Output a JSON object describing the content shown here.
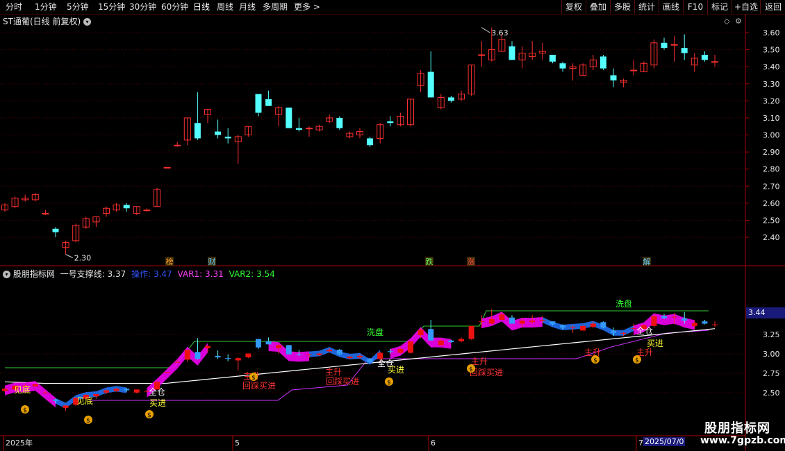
{
  "toolbar": {
    "timeframes": [
      "分时",
      "1分钟",
      "5分钟",
      "15分钟",
      "30分钟",
      "60分钟",
      "日线",
      "周线",
      "月线",
      "多周期",
      "更多 >"
    ],
    "active": "日线",
    "right_buttons": [
      "复权",
      "叠加",
      "多股",
      "统计",
      "画线",
      "F10",
      "标记",
      "+自选",
      "返回"
    ]
  },
  "main_chart": {
    "title": "ST通葡(日线 前复权)",
    "high_label": "3.63",
    "low_label": "2.30",
    "price_ticks": [
      "3.60",
      "3.50",
      "3.40",
      "3.30",
      "3.20",
      "3.10",
      "3.00",
      "2.90",
      "2.80",
      "2.70",
      "2.60",
      "2.50",
      "2.40"
    ],
    "event_markers": [
      {
        "label": "榜",
        "color": "#ffa040"
      },
      {
        "label": "财",
        "color": "#66ccff"
      },
      {
        "label": "跌",
        "color": "#66ff66"
      },
      {
        "label": "涨",
        "color": "#ff5050"
      },
      {
        "label": "解",
        "color": "#66ccff"
      }
    ]
  },
  "indicator": {
    "name": "股朋指标网",
    "line1_label": "一号支撑线:",
    "line1_value": "3.37",
    "op_label": "操作:",
    "op_value": "3.47",
    "var1_label": "VAR1:",
    "var1_value": "3.31",
    "var2_label": "VAR2:",
    "var2_value": "3.54",
    "ticks": [
      "3.25",
      "3.00",
      "2.75",
      "2.50"
    ],
    "current_price": "3.44",
    "signals": {
      "jiandi": "见底",
      "quancang": "全仓",
      "mairu": "买进",
      "xipan": "洗盘",
      "zhusheng": "主升",
      "huicai": "回踩买进"
    }
  },
  "x_axis": {
    "labels": [
      "2025年",
      "5",
      "6",
      "7"
    ],
    "current_date": "2025/07/0"
  },
  "watermark": {
    "line1": "股朋指标网",
    "line2": "www.7gpzb.com"
  },
  "colors": {
    "up": "#ff3030",
    "down": "#54ffff",
    "grid": "#5a0000",
    "axis": "#aa0000",
    "magenta": "#ff00ff",
    "white": "#ffffff",
    "green": "#33ff33",
    "purple": "#cc33ff"
  },
  "chart_data": {
    "type": "candlestick",
    "price_range": [
      2.3,
      3.63
    ],
    "candles": [
      {
        "o": 2.56,
        "h": 2.6,
        "l": 2.55,
        "c": 2.59
      },
      {
        "o": 2.58,
        "h": 2.64,
        "l": 2.57,
        "c": 2.63
      },
      {
        "o": 2.62,
        "h": 2.65,
        "l": 2.61,
        "c": 2.63
      },
      {
        "o": 2.62,
        "h": 2.66,
        "l": 2.61,
        "c": 2.65
      },
      {
        "o": 2.54,
        "h": 2.56,
        "l": 2.53,
        "c": 2.54
      },
      {
        "o": 2.45,
        "h": 2.46,
        "l": 2.4,
        "c": 2.43
      },
      {
        "o": 2.34,
        "h": 2.38,
        "l": 2.3,
        "c": 2.37
      },
      {
        "o": 2.38,
        "h": 2.48,
        "l": 2.37,
        "c": 2.47
      },
      {
        "o": 2.46,
        "h": 2.52,
        "l": 2.45,
        "c": 2.51
      },
      {
        "o": 2.49,
        "h": 2.52,
        "l": 2.46,
        "c": 2.52
      },
      {
        "o": 2.54,
        "h": 2.58,
        "l": 2.52,
        "c": 2.57
      },
      {
        "o": 2.56,
        "h": 2.6,
        "l": 2.55,
        "c": 2.59
      },
      {
        "o": 2.59,
        "h": 2.6,
        "l": 2.55,
        "c": 2.57
      },
      {
        "o": 2.54,
        "h": 2.58,
        "l": 2.53,
        "c": 2.58
      },
      {
        "o": 2.56,
        "h": 2.57,
        "l": 2.55,
        "c": 2.56
      },
      {
        "o": 2.58,
        "h": 2.69,
        "l": 2.58,
        "c": 2.68
      },
      {
        "o": 2.81,
        "h": 2.81,
        "l": 2.81,
        "c": 2.81
      },
      {
        "o": 2.94,
        "h": 2.96,
        "l": 2.93,
        "c": 2.94
      },
      {
        "o": 2.97,
        "h": 3.1,
        "l": 2.94,
        "c": 3.1
      },
      {
        "o": 3.07,
        "h": 3.25,
        "l": 2.97,
        "c": 2.98
      },
      {
        "o": 3.12,
        "h": 3.15,
        "l": 3.07,
        "c": 3.15
      },
      {
        "o": 3.02,
        "h": 3.09,
        "l": 2.98,
        "c": 3.0
      },
      {
        "o": 2.99,
        "h": 3.04,
        "l": 2.95,
        "c": 2.98
      },
      {
        "o": 2.96,
        "h": 3.0,
        "l": 2.83,
        "c": 2.99
      },
      {
        "o": 3.0,
        "h": 3.05,
        "l": 2.99,
        "c": 3.05
      },
      {
        "o": 3.24,
        "h": 3.24,
        "l": 3.11,
        "c": 3.13
      },
      {
        "o": 3.21,
        "h": 3.26,
        "l": 3.17,
        "c": 3.17
      },
      {
        "o": 3.12,
        "h": 3.17,
        "l": 3.05,
        "c": 3.16
      },
      {
        "o": 3.16,
        "h": 3.16,
        "l": 3.04,
        "c": 3.04
      },
      {
        "o": 3.04,
        "h": 3.1,
        "l": 3.02,
        "c": 3.03
      },
      {
        "o": 3.04,
        "h": 3.05,
        "l": 2.99,
        "c": 3.04
      },
      {
        "o": 3.03,
        "h": 3.06,
        "l": 3.02,
        "c": 3.05
      },
      {
        "o": 3.08,
        "h": 3.12,
        "l": 3.07,
        "c": 3.1
      },
      {
        "o": 3.1,
        "h": 3.11,
        "l": 3.03,
        "c": 3.04
      },
      {
        "o": 2.99,
        "h": 3.02,
        "l": 2.98,
        "c": 3.01
      },
      {
        "o": 3.0,
        "h": 3.04,
        "l": 2.98,
        "c": 3.02
      },
      {
        "o": 2.98,
        "h": 2.99,
        "l": 2.93,
        "c": 2.94
      },
      {
        "o": 2.98,
        "h": 3.07,
        "l": 2.95,
        "c": 3.06
      },
      {
        "o": 3.08,
        "h": 3.11,
        "l": 3.05,
        "c": 3.07
      },
      {
        "o": 3.06,
        "h": 3.13,
        "l": 3.05,
        "c": 3.11
      },
      {
        "o": 3.06,
        "h": 3.21,
        "l": 3.05,
        "c": 3.21
      },
      {
        "o": 3.29,
        "h": 3.38,
        "l": 3.25,
        "c": 3.36
      },
      {
        "o": 3.37,
        "h": 3.49,
        "l": 3.22,
        "c": 3.22
      },
      {
        "o": 3.16,
        "h": 3.24,
        "l": 3.15,
        "c": 3.22
      },
      {
        "o": 3.22,
        "h": 3.23,
        "l": 3.19,
        "c": 3.2
      },
      {
        "o": 3.21,
        "h": 3.26,
        "l": 3.2,
        "c": 3.24
      },
      {
        "o": 3.24,
        "h": 3.41,
        "l": 3.23,
        "c": 3.41
      },
      {
        "o": 3.47,
        "h": 3.55,
        "l": 3.4,
        "c": 3.47
      },
      {
        "o": 3.44,
        "h": 3.63,
        "l": 3.43,
        "c": 3.5
      },
      {
        "o": 3.49,
        "h": 3.59,
        "l": 3.49,
        "c": 3.56
      },
      {
        "o": 3.52,
        "h": 3.55,
        "l": 3.44,
        "c": 3.44
      },
      {
        "o": 3.44,
        "h": 3.52,
        "l": 3.39,
        "c": 3.48
      },
      {
        "o": 3.46,
        "h": 3.55,
        "l": 3.44,
        "c": 3.48
      },
      {
        "o": 3.48,
        "h": 3.54,
        "l": 3.44,
        "c": 3.49
      },
      {
        "o": 3.47,
        "h": 3.47,
        "l": 3.42,
        "c": 3.43
      },
      {
        "o": 3.42,
        "h": 3.43,
        "l": 3.37,
        "c": 3.39
      },
      {
        "o": 3.39,
        "h": 3.42,
        "l": 3.32,
        "c": 3.4
      },
      {
        "o": 3.35,
        "h": 3.42,
        "l": 3.35,
        "c": 3.41
      },
      {
        "o": 3.4,
        "h": 3.47,
        "l": 3.38,
        "c": 3.44
      },
      {
        "o": 3.46,
        "h": 3.47,
        "l": 3.38,
        "c": 3.39
      },
      {
        "o": 3.35,
        "h": 3.39,
        "l": 3.28,
        "c": 3.32
      },
      {
        "o": 3.31,
        "h": 3.33,
        "l": 3.28,
        "c": 3.32
      },
      {
        "o": 3.38,
        "h": 3.44,
        "l": 3.35,
        "c": 3.38
      },
      {
        "o": 3.37,
        "h": 3.43,
        "l": 3.37,
        "c": 3.42
      },
      {
        "o": 3.41,
        "h": 3.56,
        "l": 3.39,
        "c": 3.54
      },
      {
        "o": 3.54,
        "h": 3.57,
        "l": 3.5,
        "c": 3.51
      },
      {
        "o": 3.53,
        "h": 3.58,
        "l": 3.43,
        "c": 3.53
      },
      {
        "o": 3.51,
        "h": 3.59,
        "l": 3.44,
        "c": 3.48
      },
      {
        "o": 3.41,
        "h": 3.48,
        "l": 3.37,
        "c": 3.45
      },
      {
        "o": 3.47,
        "h": 3.49,
        "l": 3.43,
        "c": 3.44
      },
      {
        "o": 3.43,
        "h": 3.47,
        "l": 3.4,
        "c": 3.43
      }
    ]
  }
}
